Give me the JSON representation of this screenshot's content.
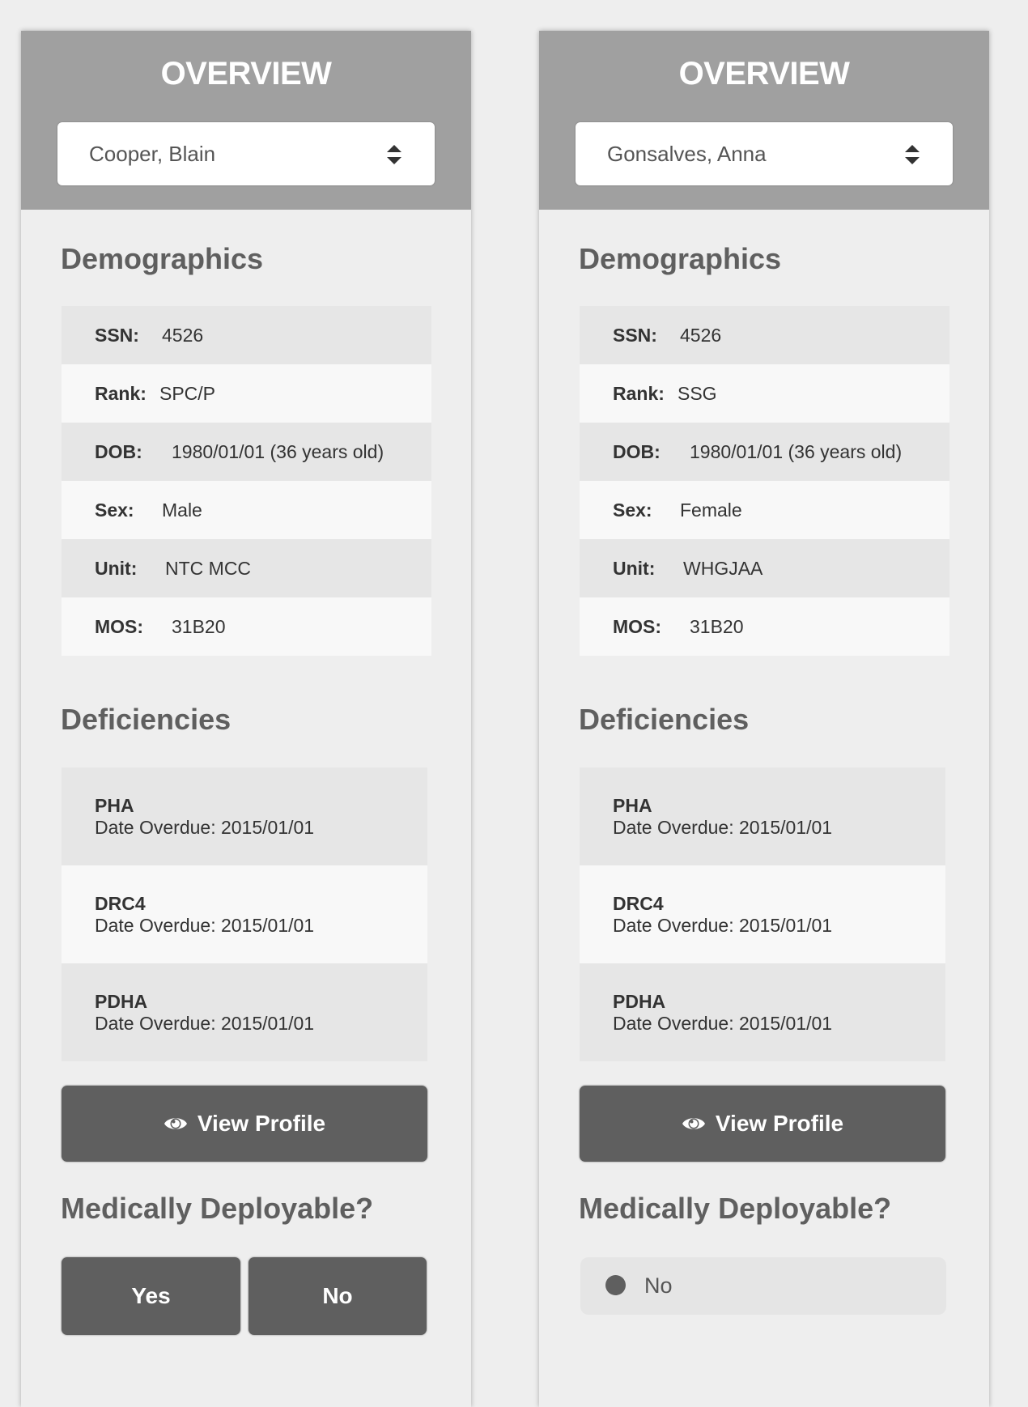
{
  "colors": {
    "page_bg": "#eeeeee",
    "header_bg": "#a0a0a0",
    "row_dark": "#e6e6e6",
    "row_light": "#f8f8f8",
    "button_bg": "#5f5f5f",
    "heading_text": "#5f5f5f"
  },
  "panels": [
    {
      "title": "OVERVIEW",
      "selected_person": "Cooper, Blain",
      "demographics_heading": "Demographics",
      "demographics": [
        {
          "label": "SSN:",
          "value": "4526"
        },
        {
          "label": "Rank:",
          "value": "SPC/P"
        },
        {
          "label": "DOB:",
          "value": "1980/01/01 (36 years old)"
        },
        {
          "label": "Sex:",
          "value": "Male"
        },
        {
          "label": "Unit:",
          "value": "NTC MCC"
        },
        {
          "label": "MOS:",
          "value": "31B20"
        }
      ],
      "deficiencies_heading": "Deficiencies",
      "deficiencies": [
        {
          "name": "PHA",
          "date_text": "Date Overdue: 2015/01/01"
        },
        {
          "name": "DRC4",
          "date_text": "Date Overdue: 2015/01/01"
        },
        {
          "name": "PDHA",
          "date_text": "Date Overdue: 2015/01/01"
        }
      ],
      "view_profile_label": "View Profile",
      "view_profile_icon": "eye-icon",
      "deployable_heading": "Medically Deployable?",
      "deployable_buttons": {
        "yes": "Yes",
        "no": "No"
      }
    },
    {
      "title": "OVERVIEW",
      "selected_person": "Gonsalves, Anna",
      "demographics_heading": "Demographics",
      "demographics": [
        {
          "label": "SSN:",
          "value": "4526"
        },
        {
          "label": "Rank:",
          "value": "SSG"
        },
        {
          "label": "DOB:",
          "value": "1980/01/01 (36 years old)"
        },
        {
          "label": "Sex:",
          "value": "Female"
        },
        {
          "label": "Unit:",
          "value": "WHGJAA"
        },
        {
          "label": "MOS:",
          "value": "31B20"
        }
      ],
      "deficiencies_heading": "Deficiencies",
      "deficiencies": [
        {
          "name": "PHA",
          "date_text": "Date Overdue: 2015/01/01"
        },
        {
          "name": "DRC4",
          "date_text": "Date Overdue: 2015/01/01"
        },
        {
          "name": "PDHA",
          "date_text": "Date Overdue: 2015/01/01"
        }
      ],
      "view_profile_label": "View Profile",
      "view_profile_icon": "eye-icon",
      "deployable_heading": "Medically Deployable?",
      "deployable_status": "No"
    }
  ]
}
